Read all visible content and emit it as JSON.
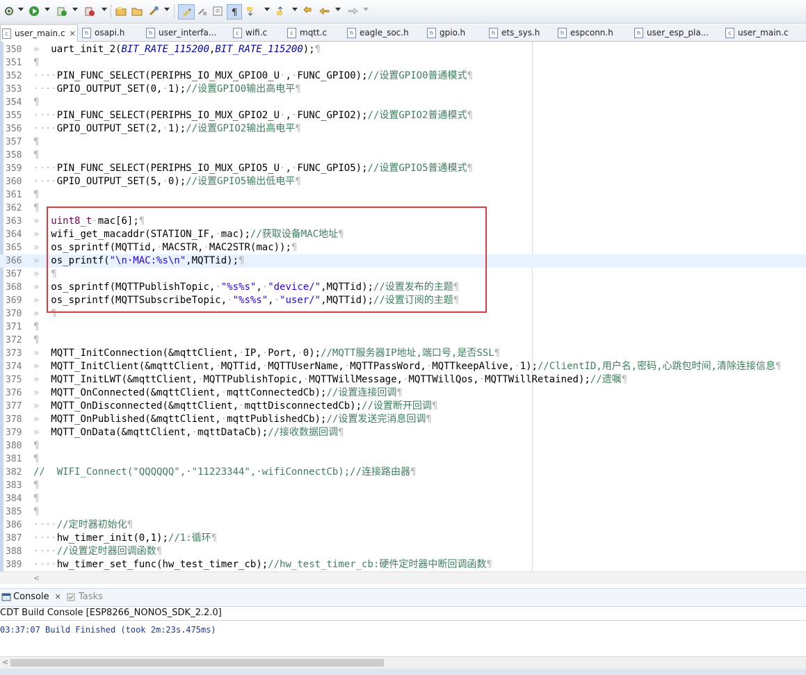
{
  "toolbar": {
    "icons": [
      "debug-gear-icon",
      "run-icon",
      "run-external-icon",
      "coverage-icon",
      "new-project-icon",
      "open-folder-icon",
      "build-icon",
      "highlight-pen-icon",
      "edit-icon",
      "toggle-block-icon",
      "show-whitespace-icon",
      "next-annotation-icon",
      "prev-annotation-icon",
      "back-icon",
      "forward-icon"
    ]
  },
  "tabs": [
    {
      "label": "user_main.c",
      "active": true,
      "type": "c"
    },
    {
      "label": "osapi.h",
      "active": false,
      "type": "h"
    },
    {
      "label": "user_interfa...",
      "active": false,
      "type": "h"
    },
    {
      "label": "wifi.c",
      "active": false,
      "type": "c"
    },
    {
      "label": "mqtt.c",
      "active": false,
      "type": "c"
    },
    {
      "label": "eagle_soc.h",
      "active": false,
      "type": "h"
    },
    {
      "label": "gpio.h",
      "active": false,
      "type": "h"
    },
    {
      "label": "ets_sys.h",
      "active": false,
      "type": "h"
    },
    {
      "label": "espconn.h",
      "active": false,
      "type": "h"
    },
    {
      "label": "user_esp_pla...",
      "active": false,
      "type": "h"
    },
    {
      "label": "user_main.c",
      "active": false,
      "type": "c"
    }
  ],
  "editor": {
    "lines": [
      {
        "n": "350",
        "t": "»  uart_init_2(BIT_RATE_115200,BIT_RATE_115200);¶"
      },
      {
        "n": "351",
        "t": "¶"
      },
      {
        "n": "352",
        "t": "····PIN_FUNC_SELECT(PERIPHS_IO_MUX_GPIO0_U·,·FUNC_GPIO0);//设置GPIO0普通模式¶"
      },
      {
        "n": "353",
        "t": "····GPIO_OUTPUT_SET(0,·1);//设置GPIO0输出高电平¶"
      },
      {
        "n": "354",
        "t": "¶"
      },
      {
        "n": "355",
        "t": "····PIN_FUNC_SELECT(PERIPHS_IO_MUX_GPIO2_U·,·FUNC_GPIO2);//设置GPIO2普通模式¶"
      },
      {
        "n": "356",
        "t": "····GPIO_OUTPUT_SET(2,·1);//设置GPIO2输出高电平¶"
      },
      {
        "n": "357",
        "t": "¶"
      },
      {
        "n": "358",
        "t": "¶"
      },
      {
        "n": "359",
        "t": "····PIN_FUNC_SELECT(PERIPHS_IO_MUX_GPIO5_U·,·FUNC_GPIO5);//设置GPIO5普通模式¶"
      },
      {
        "n": "360",
        "t": "····GPIO_OUTPUT_SET(5,·0);//设置GPIO5输出低电平¶"
      },
      {
        "n": "361",
        "t": "¶"
      },
      {
        "n": "362",
        "t": "¶"
      },
      {
        "n": "363",
        "t": "»  uint8_t·mac[6];¶"
      },
      {
        "n": "364",
        "t": "»  wifi_get_macaddr(STATION_IF,·mac);//获取设备MAC地址¶"
      },
      {
        "n": "365",
        "t": "»  os_sprintf(MQTTid,·MACSTR,·MAC2STR(mac));¶"
      },
      {
        "n": "366",
        "t": "»  os_printf(\"\\n·MAC:%s\\n\",MQTTid);¶",
        "current": true
      },
      {
        "n": "367",
        "t": "»  ¶"
      },
      {
        "n": "368",
        "t": "»  os_sprintf(MQTTPublishTopic,·\"%s%s\",·\"device/\",MQTTid);//设置发布的主题¶"
      },
      {
        "n": "369",
        "t": "»  os_sprintf(MQTTSubscribeTopic,·\"%s%s\",·\"user/\",MQTTid);//设置订阅的主题¶"
      },
      {
        "n": "370",
        "t": "»  ¶"
      },
      {
        "n": "371",
        "t": "¶"
      },
      {
        "n": "372",
        "t": "¶"
      },
      {
        "n": "373",
        "t": "»  MQTT_InitConnection(&mqttClient,·IP,·Port,·0);//MQTT服务器IP地址,端口号,是否SSL¶"
      },
      {
        "n": "374",
        "t": "»  MQTT_InitClient(&mqttClient,·MQTTid,·MQTTUserName,·MQTTPassWord,·MQTTkeepAlive,·1);//ClientID,用户名,密码,心跳包时间,清除连接信息¶"
      },
      {
        "n": "375",
        "t": "»  MQTT_InitLWT(&mqttClient,·MQTTPublishTopic,·MQTTWillMessage,·MQTTWillQos,·MQTTWillRetained);//遗嘱¶"
      },
      {
        "n": "376",
        "t": "»  MQTT_OnConnected(&mqttClient,·mqttConnectedCb);//设置连接回调¶"
      },
      {
        "n": "377",
        "t": "»  MQTT_OnDisconnected(&mqttClient,·mqttDisconnectedCb);//设置断开回调¶"
      },
      {
        "n": "378",
        "t": "»  MQTT_OnPublished(&mqttClient,·mqttPublishedCb);//设置发送完消息回调¶"
      },
      {
        "n": "379",
        "t": "»  MQTT_OnData(&mqttClient,·mqttDataCb);//接收数据回调¶"
      },
      {
        "n": "380",
        "t": "¶"
      },
      {
        "n": "381",
        "t": "¶"
      },
      {
        "n": "382",
        "t": "//  WIFI_Connect(\"QQQQQQ\",·\"11223344\",·wifiConnectCb);//连接路由器¶"
      },
      {
        "n": "383",
        "t": "¶"
      },
      {
        "n": "384",
        "t": "¶"
      },
      {
        "n": "385",
        "t": "¶"
      },
      {
        "n": "386",
        "t": "····//定时器初始化¶"
      },
      {
        "n": "387",
        "t": "····hw_timer_init(0,1);//1:循环¶"
      },
      {
        "n": "388",
        "t": "····//设置定时器回调函数¶"
      },
      {
        "n": "389",
        "t": "····hw_timer_set_func(hw_test_timer_cb);//hw_test_timer_cb:硬件定时器中断回调函数¶"
      }
    ]
  },
  "console": {
    "tabs": [
      {
        "label": "Console",
        "active": true
      },
      {
        "label": "Tasks",
        "active": false
      }
    ],
    "title": "CDT Build Console [ESP8266_NONOS_SDK_2.2.0]",
    "output": "03:37:07 Build Finished (took 2m:23s.475ms)"
  }
}
